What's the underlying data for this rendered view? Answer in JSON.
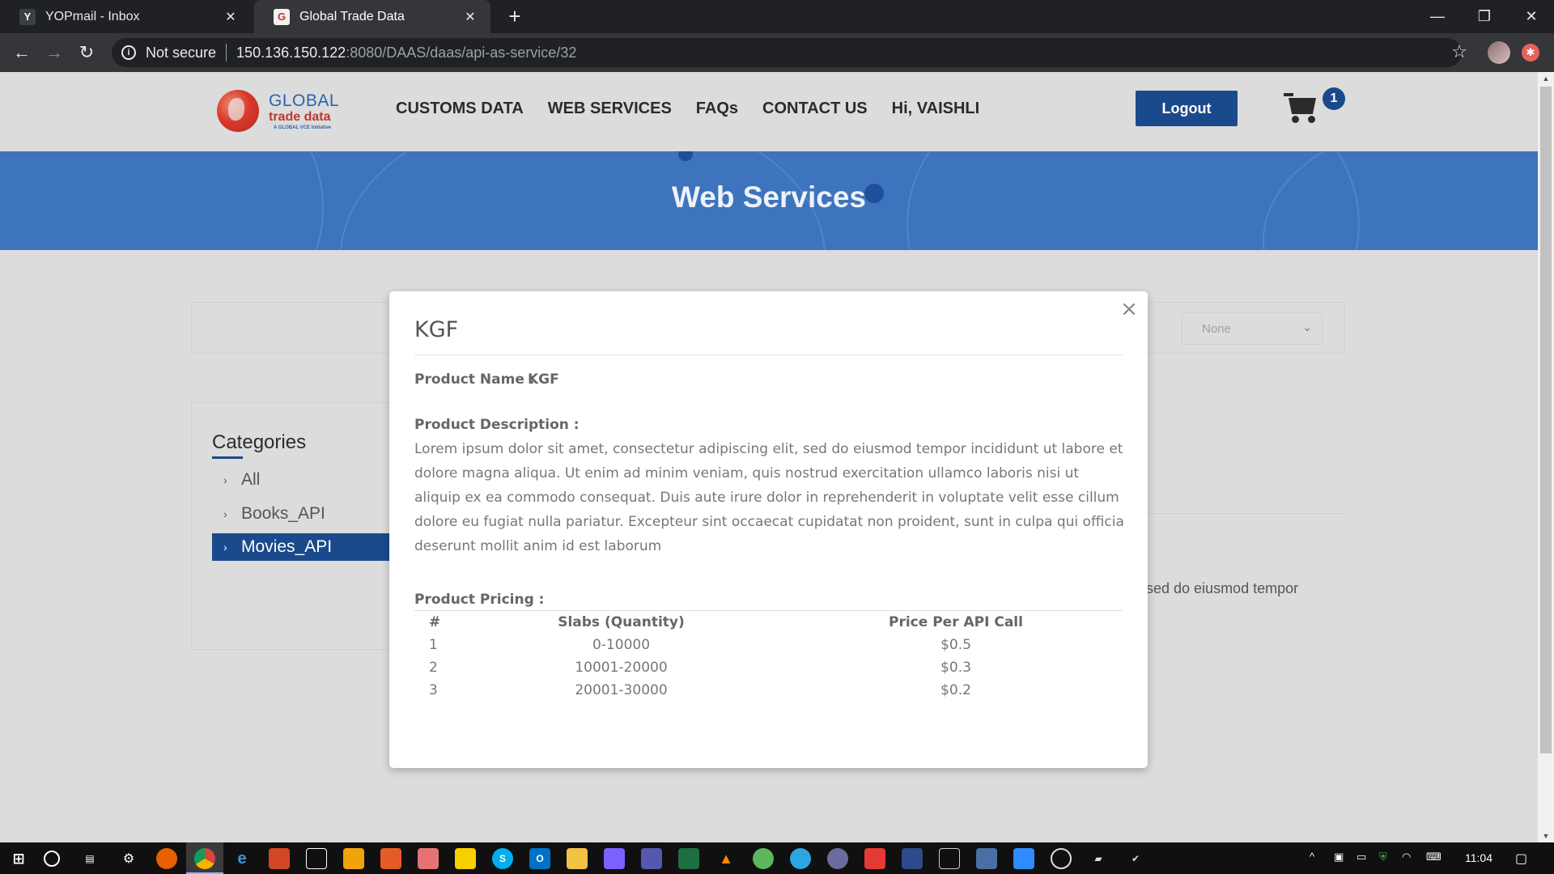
{
  "browser": {
    "tabs": [
      {
        "title": "YOPmail - Inbox",
        "icon": "yopmail-favicon",
        "active": false
      },
      {
        "title": "Global Trade Data",
        "icon": "globaltradedata-favicon",
        "active": true
      }
    ],
    "new_tab": "+",
    "security_label": "Not secure",
    "url_host": "150.136.150.122",
    "url_path": ":8080/DAAS/daas/api-as-service/32",
    "ext_badge": "✱"
  },
  "site": {
    "logo": {
      "line1": "GLOBAL",
      "line2": "trade data",
      "line3": "A GLOBAL VCE Initiative"
    },
    "nav": [
      "CUSTOMS DATA",
      "WEB SERVICES",
      "FAQs",
      "CONTACT US",
      "Hi, VAISHLI"
    ],
    "logout_label": "Logout",
    "cart_count": "1",
    "accent_color": "#1b4a8c"
  },
  "hero": {
    "title": "Web Services"
  },
  "filter": {
    "select_value": "None"
  },
  "categories": {
    "title": "Categories",
    "items": [
      {
        "label": "All",
        "active": false
      },
      {
        "label": "Books_API",
        "active": false
      },
      {
        "label": "Movies_API",
        "active": true
      }
    ]
  },
  "background_snippet": "sed do eiusmod tempor",
  "modal": {
    "title": "KGF",
    "close": "×",
    "product_name_label": "Product Name :",
    "product_name": "KGF",
    "description_label": "Product Description :",
    "description": "Lorem ipsum dolor sit amet, consectetur adipiscing elit, sed do eiusmod tempor incididunt ut labore et dolore magna aliqua. Ut enim ad minim veniam, quis nostrud exercitation ullamco laboris nisi ut aliquip ex ea commodo consequat. Duis aute irure dolor in reprehenderit in voluptate velit esse cillum dolore eu fugiat nulla pariatur. Excepteur sint occaecat cupidatat non proident, sunt in culpa qui officia deserunt mollit anim id est laborum",
    "pricing_label": "Product Pricing :",
    "pricing_headers": [
      "#",
      "Slabs (Quantity)",
      "Price Per API Call"
    ],
    "pricing_rows": [
      [
        "1",
        "0-10000",
        "$0.5"
      ],
      [
        "2",
        "10001-20000",
        "$0.3"
      ],
      [
        "3",
        "20001-30000",
        "$0.2"
      ]
    ]
  },
  "taskbar": {
    "time": "11:04"
  }
}
